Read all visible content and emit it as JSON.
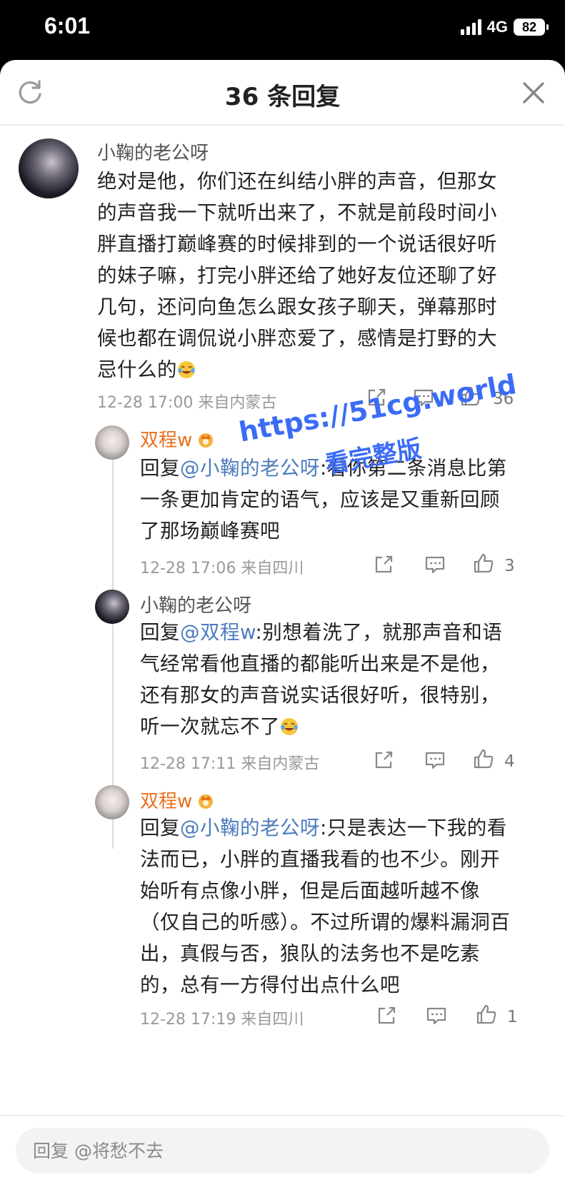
{
  "status_bar": {
    "time": "6:01",
    "network": "4G",
    "battery": "82"
  },
  "header": {
    "title": "36 条回复"
  },
  "comments": [
    {
      "user": "小鞠的老公呀",
      "text": "绝对是他，你们还在纠结小胖的声音，但那女的声音我一下就听出来了，不就是前段时间小胖直播打巅峰赛的时候排到的一个说话很好听的妹子嘛，打完小胖还给了她好友位还聊了好几句，还问向鱼怎么跟女孩子聊天，弹幕那时候也都在调侃说小胖恋爱了，感情是打野的大忌什么的",
      "meta": "12-28 17:00  来自内蒙古",
      "likes": "36"
    },
    {
      "user": "双程w",
      "reply_prefix": "回复",
      "mention": "@小鞠的老公呀",
      "text": ":看你第二条消息比第一条更加肯定的语气，应该是又重新回顾了那场巅峰赛吧",
      "meta": "12-28 17:06  来自四川",
      "likes": "3"
    },
    {
      "user": "小鞠的老公呀",
      "reply_prefix": "回复",
      "mention": "@双程w",
      "text": ":别想着洗了，就那声音和语气经常看他直播的都能听出来是不是他，还有那女的声音说实话很好听，很特别，听一次就忘不了",
      "meta": "12-28 17:11  来自内蒙古",
      "likes": "4"
    },
    {
      "user": "双程w",
      "reply_prefix": "回复",
      "mention": "@小鞠的老公呀",
      "text": ":只是表达一下我的看法而已，小胖的直播我看的也不少。刚开始听有点像小胖，但是后面越听越不像（仅自己的听感）。不过所谓的爆料漏洞百出，真假与否，狼队的法务也不是吃素的，总有一方得付出点什么吧",
      "meta": "12-28 17:19  来自四川",
      "likes": "1"
    }
  ],
  "watermark": {
    "line1": "https://51cg.world",
    "line2": "看完整版"
  },
  "input": {
    "placeholder": "回复 @将愁不去"
  },
  "colors": {
    "accent_orange": "#e8701a",
    "mention_blue": "#4d7bbd",
    "watermark_blue": "#3b6cf5"
  }
}
